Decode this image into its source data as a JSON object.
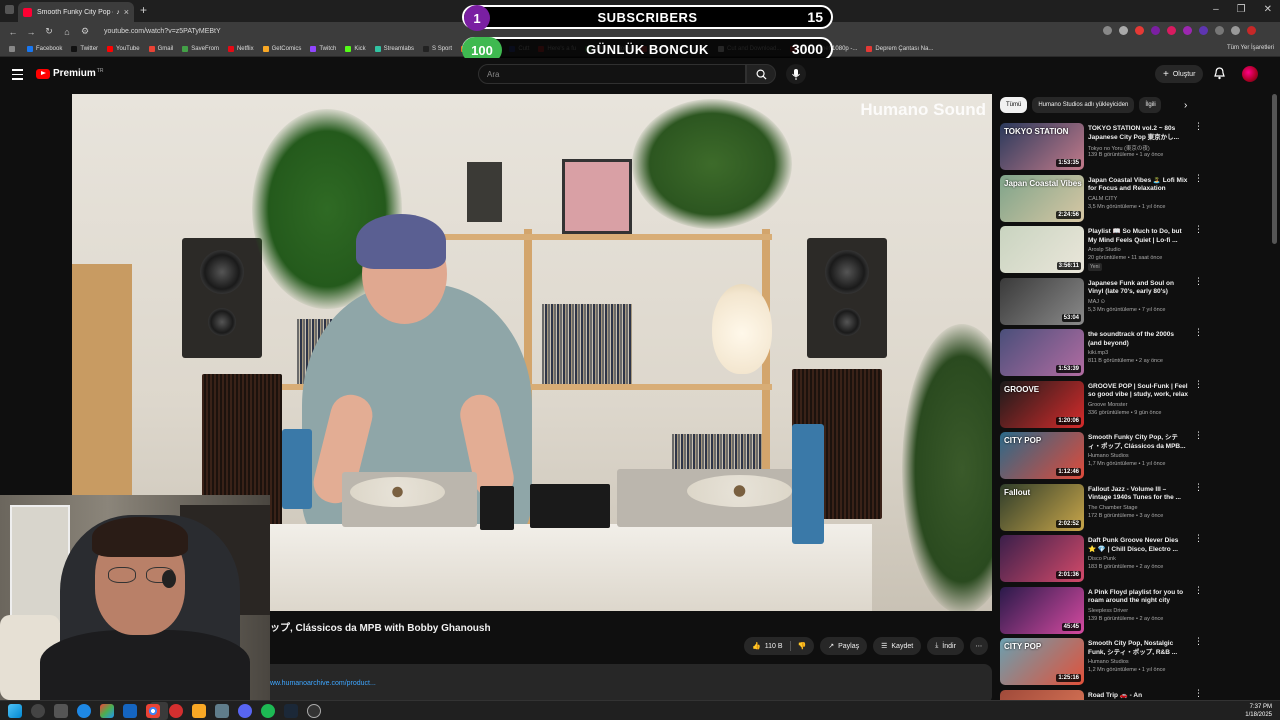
{
  "browser": {
    "tab_title": "Smooth Funky City Pop on",
    "url": "youtube.com/watch?v=z5PATyMEBtY",
    "bookmarks": [
      {
        "label": "Facebook",
        "color": "#1877f2"
      },
      {
        "label": "Twitter",
        "color": "#111111"
      },
      {
        "label": "YouTube",
        "color": "#ff0000"
      },
      {
        "label": "Gmail",
        "color": "#ea4335"
      },
      {
        "label": "SaveFrom",
        "color": "#43a047"
      },
      {
        "label": "Netflix",
        "color": "#e50914"
      },
      {
        "label": "GetComics",
        "color": "#f9a825"
      },
      {
        "label": "Twitch",
        "color": "#9146ff"
      },
      {
        "label": "Kick",
        "color": "#53fc18"
      },
      {
        "label": "Streamlabs",
        "color": "#31c3a2"
      },
      {
        "label": "S Sport",
        "color": "#222222"
      },
      {
        "label": "Crunchyroll",
        "color": "#f47521"
      },
      {
        "label": "Cutt",
        "color": "#3f51b5"
      },
      {
        "label": "Here's a fu",
        "color": "#e53935"
      },
      {
        "label": "Virtual - Home",
        "color": "#4caf50"
      },
      {
        "label": "GeoGuessr - Let's e...",
        "color": "#ff5252"
      },
      {
        "label": "Cut and Download...",
        "color": "#ffffff"
      },
      {
        "label": "MasterChef 1080p -...",
        "color": "#e53935"
      },
      {
        "label": "Deprem Çantası Na...",
        "color": "#e53935"
      }
    ],
    "all_bookmarks": "Tüm Yer İşaretleri"
  },
  "overlay": {
    "subscribers": {
      "left": "1",
      "title": "SUBSCRIBERS",
      "right": "15"
    },
    "daily": {
      "left": "100",
      "title": "GÜNLÜK BONCUK",
      "right": "3000"
    }
  },
  "youtube": {
    "logo_text": "Premium",
    "logo_sup": "TR",
    "search_placeholder": "Ara",
    "create_label": "Oluştur",
    "watermark": "Humano Sound",
    "video_title": "ップ, Clássicos da MPB with Bobby Ghanoush",
    "actions": {
      "likes": "110 B",
      "share": "Paylaş",
      "save": "Kaydet",
      "download": "İndir"
    },
    "description_link": "ww.humanoarchive.com/product..."
  },
  "sidebar": {
    "chips": [
      "Tümü",
      "Humano Studios adlı yükleyiciden",
      "İlgili"
    ],
    "recommendations": [
      {
        "thumb_text": "TOKYO STATION",
        "duration": "1:53:35",
        "title": "TOKYO STATION vol.2 ~ 80s Japanese City Pop 東京かし...",
        "channel": "Tokyo no Yoru (東京の夜)",
        "meta": "139 B görüntüleme • 1 ay önce",
        "badge": "",
        "colors": [
          "#2b3a5c",
          "#c27a8a"
        ]
      },
      {
        "thumb_text": "Japan Coastal Vibes",
        "duration": "2:24:56",
        "title": "Japan Coastal Vibes 🏝️ Lofi Mix for Focus and Relaxation",
        "channel": "CALM CITY",
        "meta": "3,5 Mn görüntüleme • 1 yıl önce",
        "badge": "",
        "colors": [
          "#7fa48a",
          "#d7c7a4"
        ]
      },
      {
        "thumb_text": "",
        "duration": "3:56:11",
        "title": "Playlist 📖 So Much to Do, but My Mind Feels Quiet | Lo-fi ...",
        "channel": "Aroslp Studio",
        "meta": "20 görüntüleme • 11 saat önce",
        "badge": "Yeni",
        "colors": [
          "#c9d4c0",
          "#eae6da"
        ]
      },
      {
        "thumb_text": "",
        "duration": "53:04",
        "title": "Japanese Funk and Soul on Vinyl (late 70's, early 80's)",
        "channel": "MAJ ⊙",
        "meta": "5,3 Mn görüntüleme • 7 yıl önce",
        "badge": "",
        "colors": [
          "#3a3a3a",
          "#8a8a8a"
        ]
      },
      {
        "thumb_text": "",
        "duration": "1:53:39",
        "title": "the soundtrack of the 2000s (and beyond)",
        "channel": "kiki.mp3",
        "meta": "811 B görüntüleme • 2 ay önce",
        "badge": "",
        "colors": [
          "#4a4f7a",
          "#b26ca2"
        ]
      },
      {
        "thumb_text": "GROOVE",
        "duration": "1:20:06",
        "title": "GROOVE POP | Soul-Funk | Feel so good vibe | study, work, relax",
        "channel": "Groove Monster",
        "meta": "336 görüntüleme • 9 gün önce",
        "badge": "",
        "colors": [
          "#1b1b1b",
          "#d62b2b"
        ]
      },
      {
        "thumb_text": "CITY POP",
        "duration": "1:12:46",
        "title": "Smooth Funky City Pop, シティ・ポップ, Clássicos da MPB...",
        "channel": "Humano Studios",
        "meta": "1,7 Mn görüntüleme • 1 yıl önce",
        "badge": "",
        "colors": [
          "#2a6a8a",
          "#e04a3a"
        ]
      },
      {
        "thumb_text": "Fallout",
        "duration": "2:02:52",
        "title": "Fallout Jazz - Volume III – Vintage 1940s Tunes for the ...",
        "channel": "The Chamber Stage",
        "meta": "172 B görüntüleme • 3 ay önce",
        "badge": "",
        "colors": [
          "#2f3d2a",
          "#c9a64a"
        ]
      },
      {
        "thumb_text": "",
        "duration": "2:01:36",
        "title": "Daft Punk Groove Never Dies ⭐ 💎 | Chill Disco, Electro ...",
        "channel": "Disco Punk",
        "meta": "183 B görüntüleme • 2 ay önce",
        "badge": "",
        "colors": [
          "#3a1f4a",
          "#d44a6a"
        ]
      },
      {
        "thumb_text": "",
        "duration": "45:45",
        "title": "A Pink Floyd playlist for you to roam around the night city",
        "channel": "Sleepless Driver",
        "meta": "139 B görüntüleme • 2 ay önce",
        "badge": "",
        "colors": [
          "#2a1a4a",
          "#d54aa0"
        ]
      },
      {
        "thumb_text": "CITY POP",
        "duration": "1:25:16",
        "title": "Smooth City Pop, Nostalgic Funk, シティ・ポップ, R&B ...",
        "channel": "Humano Studios",
        "meta": "1,2 Mn görüntüleme • 1 yıl önce",
        "badge": "",
        "colors": [
          "#6aa0b0",
          "#e2513a"
        ]
      },
      {
        "thumb_text": "",
        "duration": "",
        "title": "Road Trip 🚗 - An",
        "channel": "",
        "meta": "",
        "badge": "",
        "colors": [
          "#a04a3a",
          "#e07a5a"
        ]
      }
    ]
  },
  "taskbar": {
    "time": "7:37 PM",
    "date": "1/18/2025"
  }
}
